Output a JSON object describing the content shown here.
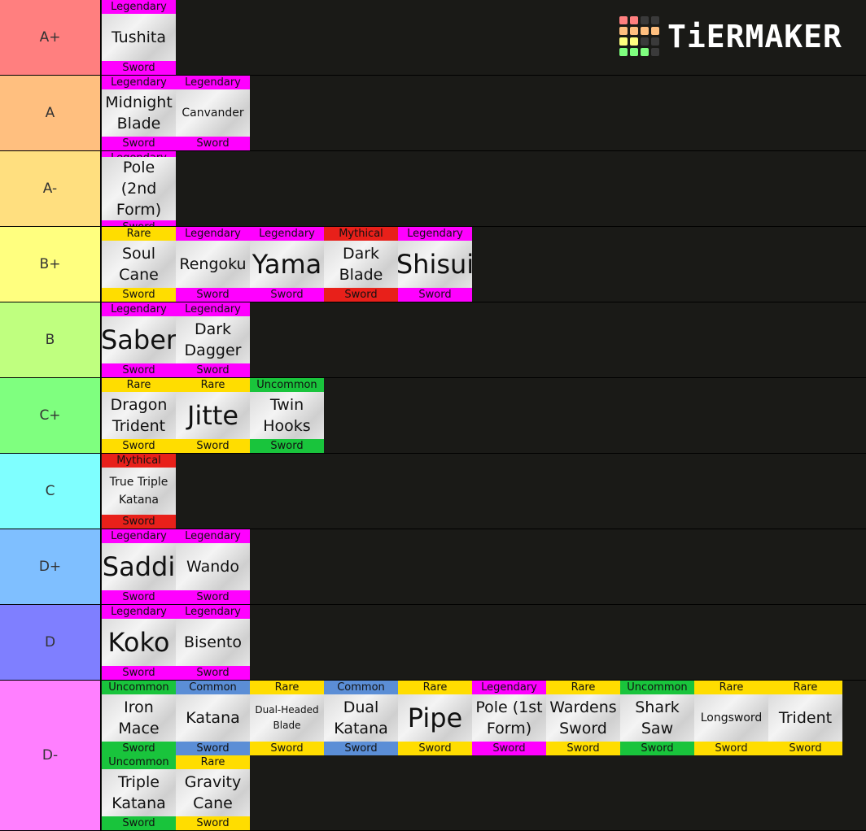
{
  "colors": {
    "Legendary": "#ff00ff",
    "Rare": "#ffdd00",
    "Mythical": "#e8201a",
    "Uncommon": "#19c43c",
    "Common": "#5b8ed6"
  },
  "logo": {
    "text": "TiERMAKER",
    "grid": [
      "#ff7f7f",
      "#ff7f7f",
      "#3a3a3a",
      "#3a3a3a",
      "#ffbf7f",
      "#ffbf7f",
      "#ffbf7f",
      "#ffbf7f",
      "#ffff7f",
      "#ffff7f",
      "#3a3a3a",
      "#3a3a3a",
      "#7fff7f",
      "#7fff7f",
      "#7fff7f",
      "#3a3a3a"
    ]
  },
  "tiers": [
    {
      "label": "A+",
      "color": "#ff7f7f",
      "items": [
        {
          "name": "Tushita",
          "rarity": "Legendary",
          "type": "Sword",
          "size": "m"
        }
      ]
    },
    {
      "label": "A",
      "color": "#ffbf7f",
      "items": [
        {
          "name": "Midnight Blade",
          "rarity": "Legendary",
          "type": "Sword",
          "size": "m"
        },
        {
          "name": "Canvander",
          "rarity": "Legendary",
          "type": "Sword",
          "size": "sm"
        }
      ]
    },
    {
      "label": "A-",
      "color": "#ffdf7f",
      "items": [
        {
          "name": "Pole (2nd Form)",
          "rarity": "Legendary",
          "type": "Sword",
          "size": "m"
        }
      ]
    },
    {
      "label": "B+",
      "color": "#ffff7f",
      "items": [
        {
          "name": "Soul Cane",
          "rarity": "Rare",
          "type": "Sword",
          "size": "m"
        },
        {
          "name": "Rengoku",
          "rarity": "Legendary",
          "type": "Sword",
          "size": "m"
        },
        {
          "name": "Yama",
          "rarity": "Legendary",
          "type": "Sword",
          "size": "big"
        },
        {
          "name": "Dark Blade",
          "rarity": "Mythical",
          "type": "Sword",
          "size": "m"
        },
        {
          "name": "Shisui",
          "rarity": "Legendary",
          "type": "Sword",
          "size": "big"
        }
      ]
    },
    {
      "label": "B",
      "color": "#bfff7f",
      "items": [
        {
          "name": "Saber",
          "rarity": "Legendary",
          "type": "Sword",
          "size": "big"
        },
        {
          "name": "Dark Dagger",
          "rarity": "Legendary",
          "type": "Sword",
          "size": "m"
        }
      ]
    },
    {
      "label": "C+",
      "color": "#7fff7f",
      "items": [
        {
          "name": "Dragon Trident",
          "rarity": "Rare",
          "type": "Sword",
          "size": "m"
        },
        {
          "name": "Jitte",
          "rarity": "Rare",
          "type": "Sword",
          "size": "big"
        },
        {
          "name": "Twin Hooks",
          "rarity": "Uncommon",
          "type": "Sword",
          "size": "m"
        }
      ]
    },
    {
      "label": "C",
      "color": "#7fffff",
      "items": [
        {
          "name": "True Triple Katana",
          "rarity": "Mythical",
          "type": "Sword",
          "size": "sm"
        }
      ]
    },
    {
      "label": "D+",
      "color": "#7fbfff",
      "items": [
        {
          "name": "Saddi",
          "rarity": "Legendary",
          "type": "Sword",
          "size": "big"
        },
        {
          "name": "Wando",
          "rarity": "Legendary",
          "type": "Sword",
          "size": "m"
        }
      ]
    },
    {
      "label": "D",
      "color": "#7f7fff",
      "items": [
        {
          "name": "Koko",
          "rarity": "Legendary",
          "type": "Sword",
          "size": "big"
        },
        {
          "name": "Bisento",
          "rarity": "Legendary",
          "type": "Sword",
          "size": "m"
        }
      ]
    },
    {
      "label": "D-",
      "color": "#ff7fff",
      "items": [
        {
          "name": "Iron Mace",
          "rarity": "Uncommon",
          "type": "Sword",
          "size": "m"
        },
        {
          "name": "Katana",
          "rarity": "Common",
          "type": "Sword",
          "size": "m"
        },
        {
          "name": "Dual-Headed Blade",
          "rarity": "Rare",
          "type": "Sword",
          "size": "xs"
        },
        {
          "name": "Dual Katana",
          "rarity": "Common",
          "type": "Sword",
          "size": "m"
        },
        {
          "name": "Pipe",
          "rarity": "Rare",
          "type": "Sword",
          "size": "big"
        },
        {
          "name": "Pole (1st Form)",
          "rarity": "Legendary",
          "type": "Sword",
          "size": "m"
        },
        {
          "name": "Wardens Sword",
          "rarity": "Rare",
          "type": "Sword",
          "size": "m"
        },
        {
          "name": "Shark Saw",
          "rarity": "Uncommon",
          "type": "Sword",
          "size": "m"
        },
        {
          "name": "Longsword",
          "rarity": "Rare",
          "type": "Sword",
          "size": "sm"
        },
        {
          "name": "Trident",
          "rarity": "Rare",
          "type": "Sword",
          "size": "m"
        },
        {
          "name": "Triple Katana",
          "rarity": "Uncommon",
          "type": "Sword",
          "size": "m"
        },
        {
          "name": "Gravity Cane",
          "rarity": "Rare",
          "type": "Sword",
          "size": "m"
        }
      ]
    }
  ]
}
